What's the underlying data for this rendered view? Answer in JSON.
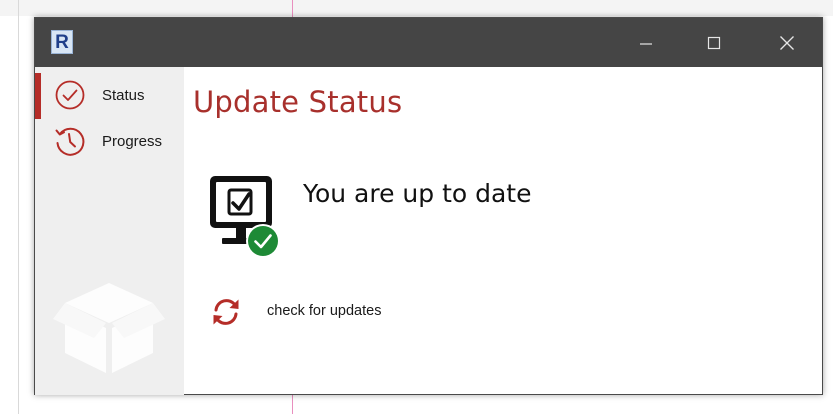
{
  "window": {
    "app_logo_letter": "R",
    "controls": {
      "minimize_icon": "minimize-icon",
      "maximize_icon": "maximize-icon",
      "close_icon": "close-icon"
    }
  },
  "sidebar": {
    "items": [
      {
        "label": "Status",
        "icon": "check-circle-icon",
        "active": true
      },
      {
        "label": "Progress",
        "icon": "history-clock-icon",
        "active": false
      }
    ],
    "watermark_icon": "box-icon"
  },
  "main": {
    "title": "Update Status",
    "status_message": "You are up to date",
    "status_icon": "monitor-checkmark-icon",
    "check_link_label": "check for updates",
    "check_link_icon": "refresh-icon"
  },
  "colors": {
    "accent": "#a8302c",
    "titlebar": "#454545",
    "sidebar_bg": "#efefef",
    "success": "#1e8a36"
  }
}
